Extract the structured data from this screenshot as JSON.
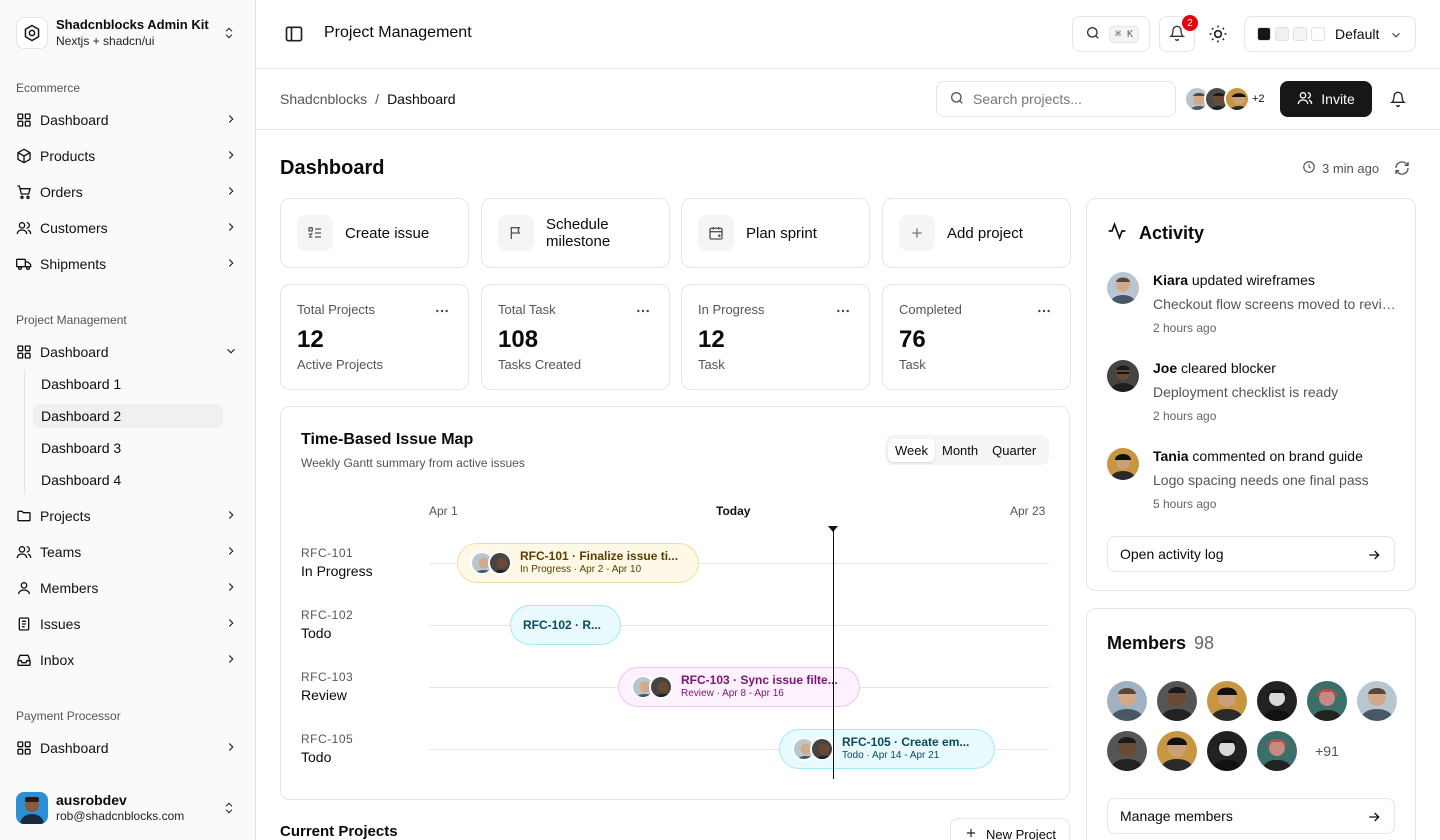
{
  "brand": {
    "title": "Shadcnblocks Admin Kit",
    "subtitle": "Nextjs + shadcn/ui"
  },
  "sidebar": {
    "groups": [
      {
        "label": "Ecommerce",
        "items": [
          "Dashboard",
          "Products",
          "Orders",
          "Customers",
          "Shipments"
        ]
      },
      {
        "label": "Project Management",
        "items": [
          "Dashboard",
          "Projects",
          "Teams",
          "Members",
          "Issues",
          "Inbox"
        ],
        "subitems": [
          "Dashboard 1",
          "Dashboard 2",
          "Dashboard 3",
          "Dashboard 4"
        ],
        "active_subitem": "Dashboard 2"
      },
      {
        "label": "Payment Processor",
        "items": [
          "Dashboard"
        ]
      }
    ],
    "user": {
      "name": "ausrobdev",
      "email": "rob@shadcnblocks.com"
    }
  },
  "topbar": {
    "title": "Project Management",
    "search_shortcut": "⌘ K",
    "notification_count": "2",
    "theme": "Default",
    "theme_swatches": [
      "#171717",
      "#f0f0f0",
      "#f5f5f5",
      "#ffffff"
    ]
  },
  "subheader": {
    "breadcrumb_root": "Shadcnblocks",
    "breadcrumb_sep": "/",
    "breadcrumb_current": "Dashboard",
    "search_placeholder": "Search projects...",
    "extra_members": "+2",
    "invite_label": "Invite"
  },
  "main": {
    "title": "Dashboard",
    "updated": "3 min ago",
    "quick_actions": [
      {
        "label": "Create issue",
        "icon": "list-checks-icon"
      },
      {
        "label": "Schedule milestone",
        "icon": "flag-icon"
      },
      {
        "label": "Plan sprint",
        "icon": "calendar-plus-icon"
      },
      {
        "label": "Add project",
        "icon": "plus-icon"
      }
    ],
    "stats": [
      {
        "label": "Total Projects",
        "value": "12",
        "sub": "Active Projects"
      },
      {
        "label": "Total Task",
        "value": "108",
        "sub": "Tasks Created"
      },
      {
        "label": "In Progress",
        "value": "12",
        "sub": "Task"
      },
      {
        "label": "Completed",
        "value": "76",
        "sub": "Task"
      }
    ],
    "gantt": {
      "title": "Time-Based Issue Map",
      "subtitle": "Weekly Gantt summary from active issues",
      "ranges": [
        "Week",
        "Month",
        "Quarter"
      ],
      "active_range": "Week",
      "axis_start": "Apr 1",
      "axis_today": "Today",
      "axis_end": "Apr 23",
      "rows": [
        {
          "id": "RFC-101",
          "status": "In Progress",
          "bar_title": "RFC-101 · Finalize issue ti...",
          "bar_meta": "In Progress · Apr 2 - Apr 10",
          "bg": "#fef9e6",
          "border": "#f3dea0",
          "fg": "#5a3e00"
        },
        {
          "id": "RFC-102",
          "status": "Todo",
          "bar_title": "RFC-102 · R...",
          "bar_meta": "",
          "bg": "#e8fafd",
          "border": "#a8e6f2",
          "fg": "#0b4a5a"
        },
        {
          "id": "RFC-103",
          "status": "Review",
          "bar_title": "RFC-103 · Sync issue filte...",
          "bar_meta": "Review · Apr 8 - Apr 16",
          "bg": "#fcf1fc",
          "border": "#efc6ef",
          "fg": "#7a1477"
        },
        {
          "id": "RFC-105",
          "status": "Todo",
          "bar_title": "RFC-105 · Create em...",
          "bar_meta": "Todo · Apr 14 - Apr 21",
          "bg": "#e8fafd",
          "border": "#a8e6f2",
          "fg": "#0b4a5a"
        }
      ]
    },
    "current_projects": "Current Projects",
    "new_project_label": "New Project"
  },
  "activity": {
    "title": "Activity",
    "items": [
      {
        "name": "Kiara",
        "action": "updated wireframes",
        "detail": "Checkout flow screens moved to review",
        "time": "2 hours ago"
      },
      {
        "name": "Joe",
        "action": "cleared blocker",
        "detail": "Deployment checklist is ready",
        "time": "2 hours ago"
      },
      {
        "name": "Tania",
        "action": "commented on brand guide",
        "detail": "Logo spacing needs one final pass",
        "time": "5 hours ago"
      }
    ],
    "open_log_label": "Open activity log"
  },
  "members": {
    "title": "Members",
    "count": "98",
    "more": "+91",
    "manage_label": "Manage members"
  }
}
